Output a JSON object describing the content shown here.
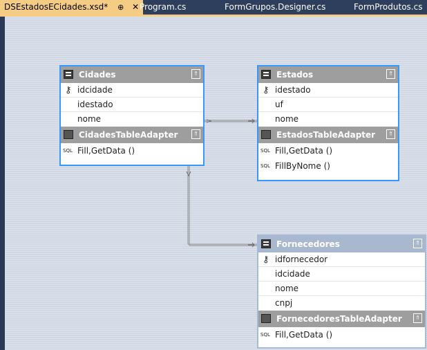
{
  "tabs": [
    {
      "label": "DSEstadosECidades.xsd*",
      "active": true,
      "pin": "⊕",
      "close": "✕"
    },
    {
      "label": "Program.cs"
    },
    {
      "label": "FormGrupos.Designer.cs"
    },
    {
      "label": "FormProdutos.cs"
    }
  ],
  "tables": {
    "cidades": {
      "name": "Cidades",
      "columns": [
        "idcidade",
        "idestado",
        "nome"
      ],
      "adapter": "CidadesTableAdapter",
      "queries": [
        "Fill,GetData ()"
      ]
    },
    "estados": {
      "name": "Estados",
      "columns": [
        "idestado",
        "uf",
        "nome"
      ],
      "adapter": "EstadosTableAdapter",
      "queries": [
        "Fill,GetData ()",
        "FillByNome ()"
      ]
    },
    "fornecedores": {
      "name": "Fornecedores",
      "columns": [
        "idfornecedor",
        "idcidade",
        "nome",
        "cnpj"
      ],
      "adapter": "FornecedoresTableAdapter",
      "queries": [
        "Fill,GetData ()"
      ]
    }
  },
  "icons": {
    "key": "key-icon",
    "sql": "SQL",
    "collapse": "⇑"
  },
  "colors": {
    "tab_active": "#f5cc84",
    "tab_strip": "#2d3f5c",
    "selected_border": "#3399ff",
    "header_gray": "#9e9e9e"
  }
}
